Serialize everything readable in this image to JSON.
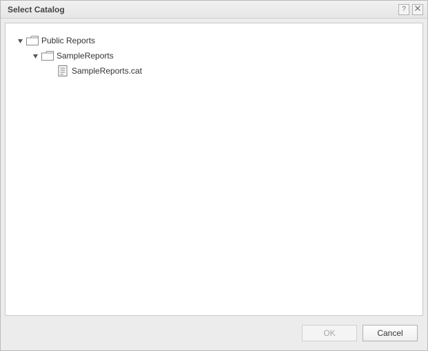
{
  "dialog": {
    "title": "Select Catalog"
  },
  "titlebar": {
    "help_tooltip": "Help",
    "close_tooltip": "Close"
  },
  "tree": {
    "items": [
      {
        "label": "Public Reports"
      },
      {
        "label": "SampleReports"
      },
      {
        "label": "SampleReports.cat"
      }
    ]
  },
  "footer": {
    "ok_label": "OK",
    "cancel_label": "Cancel",
    "ok_disabled": true
  }
}
